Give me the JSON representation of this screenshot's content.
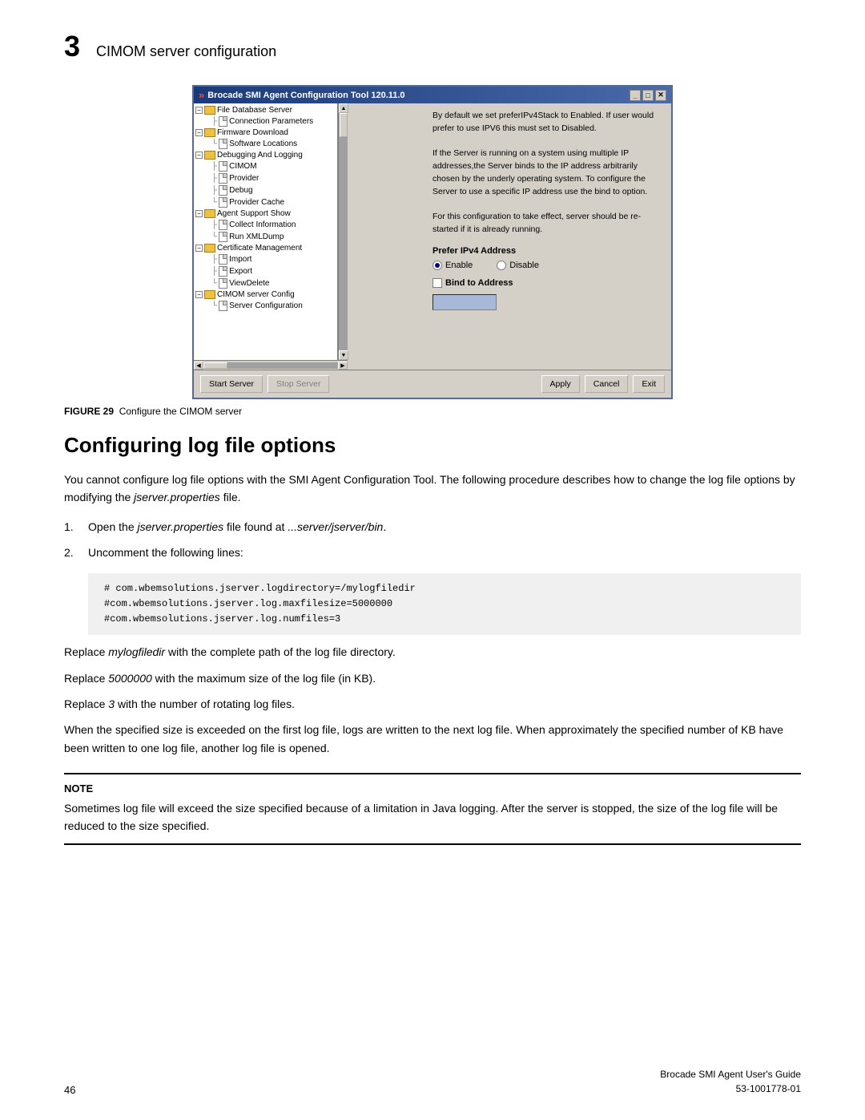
{
  "header": {
    "chapter_number": "3",
    "chapter_title": "CIMOM server configuration"
  },
  "figure": {
    "title": "Brocade SMI Agent Configuration Tool 120.11.0",
    "caption_number": "FIGURE 29",
    "caption_text": "Configure the CIMOM server",
    "tree": {
      "items": [
        {
          "indent": 0,
          "type": "folder-expanded",
          "label": "File Database Server",
          "level": 0
        },
        {
          "indent": 1,
          "type": "file",
          "label": "Connection Parameters",
          "level": 1
        },
        {
          "indent": 0,
          "type": "folder-expanded",
          "label": "Firmware Download",
          "level": 0
        },
        {
          "indent": 1,
          "type": "file",
          "label": "Software Locations",
          "level": 1
        },
        {
          "indent": 0,
          "type": "folder-expanded",
          "label": "Debugging And Logging",
          "level": 0
        },
        {
          "indent": 1,
          "type": "file",
          "label": "CIMOM",
          "level": 1
        },
        {
          "indent": 1,
          "type": "file",
          "label": "Provider",
          "level": 1
        },
        {
          "indent": 1,
          "type": "file",
          "label": "Debug",
          "level": 1
        },
        {
          "indent": 1,
          "type": "file",
          "label": "Provider Cache",
          "level": 1
        },
        {
          "indent": 0,
          "type": "folder-expanded",
          "label": "Agent Support Show",
          "level": 0
        },
        {
          "indent": 1,
          "type": "file",
          "label": "Collect Information",
          "level": 1
        },
        {
          "indent": 1,
          "type": "file",
          "label": "Run XMLDump",
          "level": 1
        },
        {
          "indent": 0,
          "type": "folder-expanded",
          "label": "Certificate Management",
          "level": 0
        },
        {
          "indent": 1,
          "type": "file",
          "label": "Import",
          "level": 1
        },
        {
          "indent": 1,
          "type": "file",
          "label": "Export",
          "level": 1
        },
        {
          "indent": 1,
          "type": "file",
          "label": "ViewDelete",
          "level": 1
        },
        {
          "indent": 0,
          "type": "folder-expanded",
          "label": "CIMOM server Config",
          "level": 0
        },
        {
          "indent": 1,
          "type": "file",
          "label": "Server Configuration",
          "level": 1
        }
      ]
    },
    "content": {
      "description": "By default we set preferIPv4Stack to Enabled. If user would prefer to use IPV6 this must set to Disabled.\nIf the Server is running on a system using multiple IP addresses,the Server binds to the IP address arbitrarily chosen by the underly operating system. To configure the Server to use a specific IP address use the bind to option.\nFor this configuration to take effect, server should be re-started if it is already running.",
      "prefer_label": "Prefer IPv4 Address",
      "enable_label": "Enable",
      "disable_label": "Disable",
      "bind_label": "Bind to Address"
    },
    "buttons": {
      "start_server": "Start Server",
      "stop_server": "Stop Server",
      "apply": "Apply",
      "cancel": "Cancel",
      "exit": "Exit"
    }
  },
  "section": {
    "title": "Configuring log file options",
    "intro": "You cannot configure log file options with the SMI Agent Configuration Tool. The following procedure describes how to change the log file options by modifying the jserver.properties file.",
    "steps": [
      {
        "number": "1.",
        "text": "Open the jserver.properties file found at ...server/jserver/bin."
      },
      {
        "number": "2.",
        "text": "Uncomment the following lines:"
      }
    ],
    "code": "# com.wbemsolutions.jserver.logdirectory=/mylogfiledir\n#com.wbemsolutions.jserver.log.maxfilesize=5000000\n#com.wbemsolutions.jserver.log.numfiles=3",
    "replace_lines": [
      "Replace mylogfiledir with the complete path of the log file directory.",
      "Replace 5000000 with the maximum size of the log file (in KB).",
      "Replace 3 with the number of rotating log files."
    ],
    "closing_text": "When the specified size is exceeded on the first log file, logs are written to the next log file. When approximately the specified number of KB have been written to one log file, another log file is opened.",
    "note": {
      "label": "NOTE",
      "text": "Sometimes log file will exceed the size specified because of a limitation in Java logging. After the server is stopped, the size of the log file will be reduced to the size specified."
    }
  },
  "footer": {
    "page_number": "46",
    "doc_title": "Brocade SMI Agent User's Guide",
    "doc_number": "53-1001778-01"
  }
}
